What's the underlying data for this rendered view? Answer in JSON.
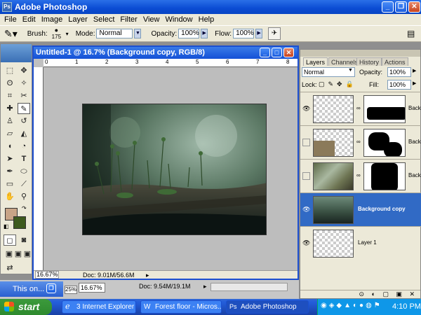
{
  "app": {
    "title": "Adobe Photoshop"
  },
  "menu": [
    "File",
    "Edit",
    "Image",
    "Layer",
    "Select",
    "Filter",
    "View",
    "Window",
    "Help"
  ],
  "options": {
    "brush_label": "Brush:",
    "brush_size": "175",
    "mode_label": "Mode:",
    "mode_value": "Normal",
    "opacity_label": "Opacity:",
    "opacity_value": "100%",
    "flow_label": "Flow:",
    "flow_value": "100%"
  },
  "document": {
    "title": "Untitled-1 @ 16.7% (Background copy, RGB/8)",
    "ruler_marks": [
      "0",
      "1",
      "2",
      "3",
      "4",
      "5",
      "6",
      "7",
      "8"
    ],
    "zoom": "16.67%",
    "doc_info": "Doc: 9.01M/56.6M"
  },
  "second_window": {
    "title": "This on...",
    "zoom": "25%",
    "zoom2": "16.67%",
    "doc_info": "Doc: 9.54M/19.1M"
  },
  "layers_palette": {
    "tabs": [
      "Layers",
      "Channels",
      "History",
      "Actions"
    ],
    "blend_mode": "Normal",
    "opacity_label": "Opacity:",
    "opacity_value": "100%",
    "lock_label": "Lock:",
    "fill_label": "Fill:",
    "fill_value": "100%",
    "layers": [
      {
        "name": "Back",
        "visible": true,
        "selected": false
      },
      {
        "name": "Back",
        "visible": false,
        "selected": false
      },
      {
        "name": "Back",
        "visible": false,
        "selected": false
      },
      {
        "name": "Background copy",
        "visible": true,
        "selected": true
      },
      {
        "name": "Layer 1",
        "visible": true,
        "selected": false
      }
    ]
  },
  "taskbar": {
    "start": "start",
    "items": [
      "3 Internet Explorer",
      "Forest floor - Micros...",
      "Adobe Photoshop"
    ],
    "clock": "4:10 PM"
  },
  "colors": {
    "foreground": "#c8a487",
    "background": "#3d5a1e",
    "selection": "#316ac5"
  }
}
